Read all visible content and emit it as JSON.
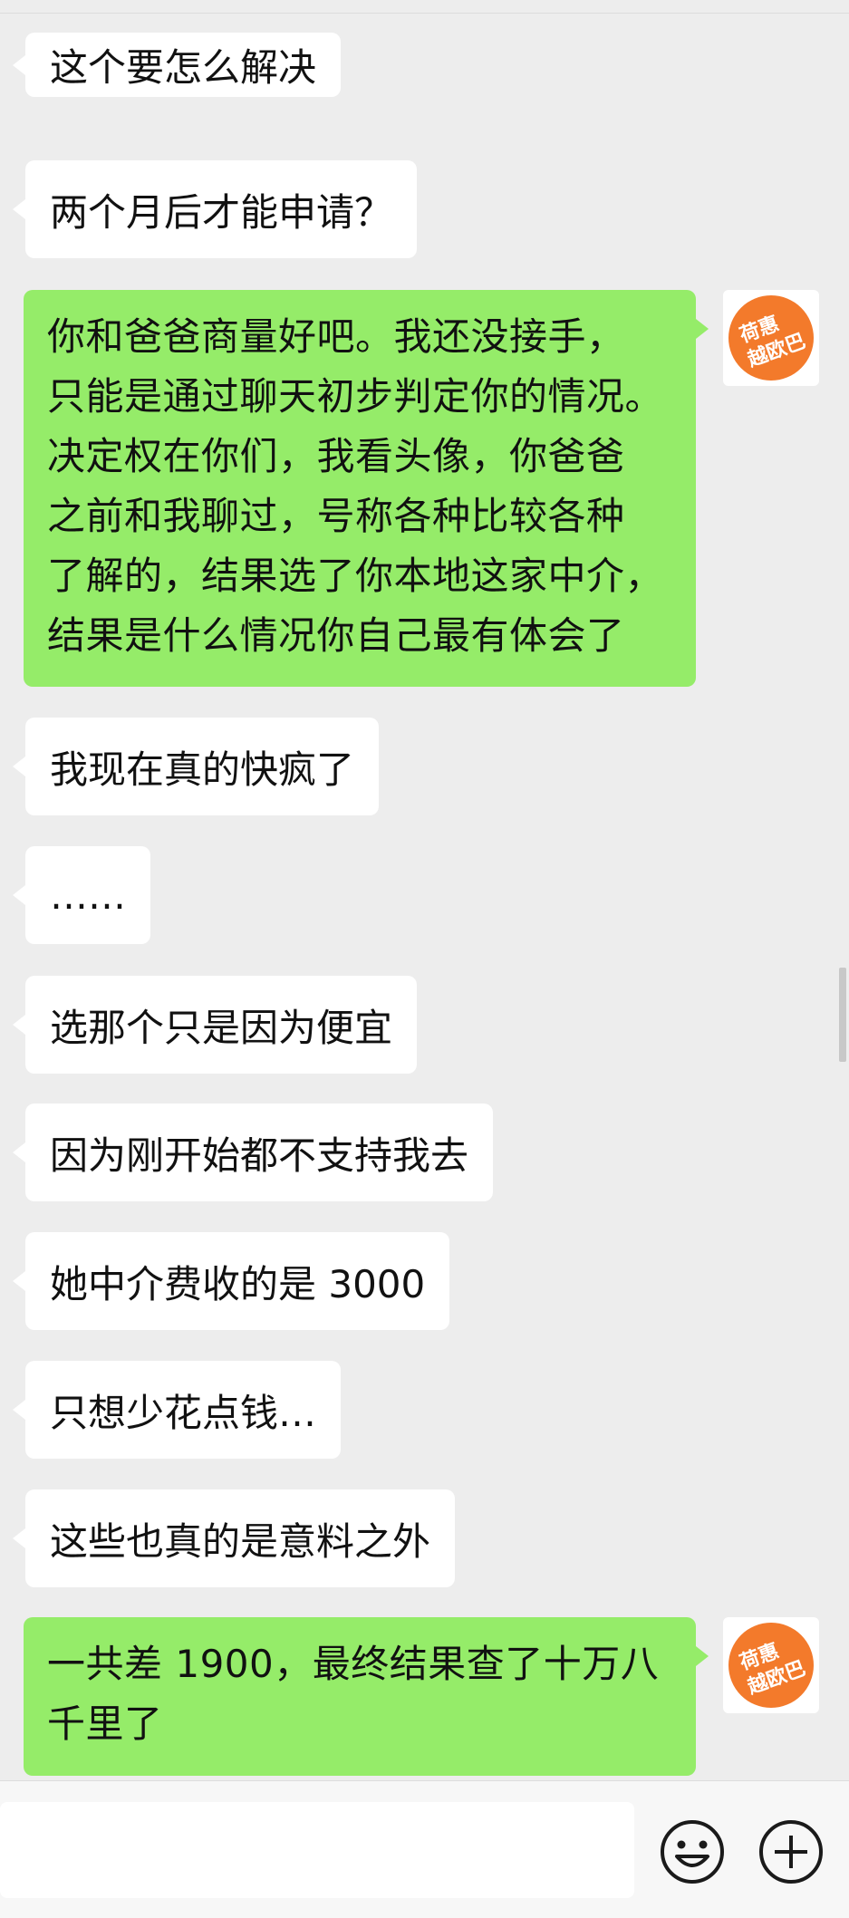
{
  "messages": [
    {
      "side": "left",
      "lines": [
        "这个要怎么解决"
      ]
    },
    {
      "side": "left",
      "lines": [
        "两个月后才能申请？"
      ]
    },
    {
      "side": "right",
      "avatar": {
        "text_line1": "荷惠",
        "text_line2": "越欧巴",
        "color": "#f37a2b"
      },
      "lines": [
        "你和爸爸商量好吧。我还没接手，",
        "只能是通过聊天初步判定你的情况。",
        "决定权在你们，我看头像，你爸爸",
        "之前和我聊过，号称各种比较各种",
        "了解的，结果选了你本地这家中介，",
        "结果是什么情况你自己最有体会了"
      ]
    },
    {
      "side": "left",
      "lines": [
        "我现在真的快疯了"
      ]
    },
    {
      "side": "left",
      "lines": [
        "……"
      ]
    },
    {
      "side": "left",
      "lines": [
        "选那个只是因为便宜"
      ]
    },
    {
      "side": "left",
      "lines": [
        "因为刚开始都不支持我去"
      ]
    },
    {
      "side": "left",
      "lines": [
        "她中介费收的是 3000"
      ]
    },
    {
      "side": "left",
      "lines": [
        "只想少花点钱…"
      ]
    },
    {
      "side": "left",
      "lines": [
        "这些也真的是意料之外"
      ]
    },
    {
      "side": "right",
      "avatar": {
        "text_line1": "荷惠",
        "text_line2": "越欧巴",
        "color": "#f37a2b"
      },
      "lines": [
        "一共差 1900，最终结果查了十万八",
        "千里了"
      ]
    }
  ],
  "input_bar": {
    "message_input_value": "",
    "emoji_icon": "emoji-smile-icon",
    "more_icon": "plus-circle-icon"
  },
  "colors": {
    "background": "#ededed",
    "incoming_bubble": "#ffffff",
    "outgoing_bubble": "#95ec69",
    "avatar_orange": "#f37a2b"
  }
}
